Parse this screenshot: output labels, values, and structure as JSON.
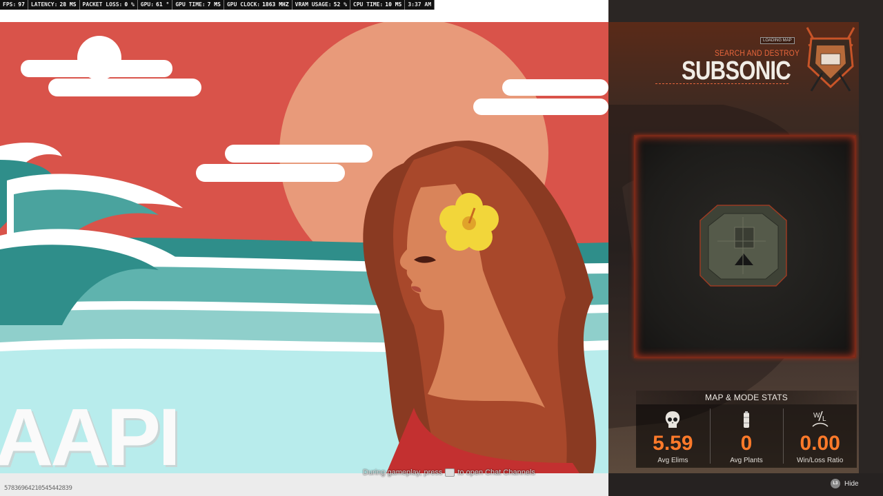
{
  "perf_overlay": [
    {
      "label": "FPS:",
      "value": "97"
    },
    {
      "label": "LATENCY:",
      "value": "28 MS"
    },
    {
      "label": "PACKET LOSS:",
      "value": "0 %"
    },
    {
      "label": "GPU:",
      "value": "61 °"
    },
    {
      "label": "GPU TIME:",
      "value": "7 MS"
    },
    {
      "label": "GPU CLOCK:",
      "value": "1863 MHZ"
    },
    {
      "label": "VRAM USAGE:",
      "value": "52 %"
    },
    {
      "label": "CPU TIME:",
      "value": "10 MS"
    },
    {
      "label": "",
      "value": "3:37 AM"
    }
  ],
  "art": {
    "text": "AAPI"
  },
  "loading": {
    "tag": "LOADING MAP",
    "mode": "SEARCH AND DESTROY",
    "map_name": "SUBSONIC"
  },
  "stats": {
    "title": "MAP & MODE STATS",
    "items": [
      {
        "icon": "skull-icon",
        "value": "5.59",
        "label": "Avg Elims"
      },
      {
        "icon": "bomb-icon",
        "value": "0",
        "label": "Avg Plants"
      },
      {
        "icon": "win-loss-icon",
        "value": "0.00",
        "label": "Win/Loss Ratio"
      }
    ]
  },
  "footer": {
    "session_id": "57836964210545442839",
    "hint_before": "During gameplay, press",
    "hint_after": "to open Chat Channels",
    "hide_button_glyph": "L3",
    "hide_label": "Hide"
  },
  "colors": {
    "accent_orange": "#ff7a2a",
    "mode_orange": "#e8663c",
    "poster_red": "#d9534a",
    "minimap_glow": "#c5381f"
  }
}
